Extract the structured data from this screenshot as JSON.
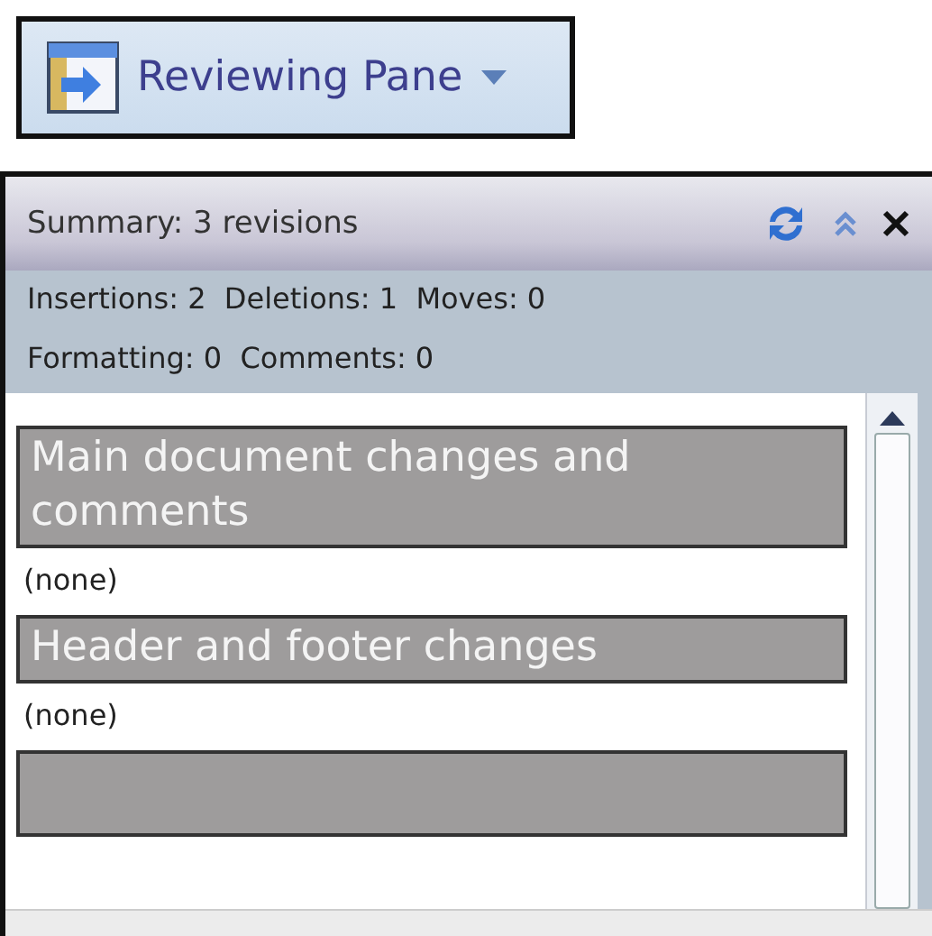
{
  "ribbon_button": {
    "label": "Reviewing Pane"
  },
  "pane": {
    "summary": "Summary: 3 revisions",
    "stats": [
      "Insertions: 2  Deletions: 1  Moves: 0",
      "Formatting: 0  Comments: 0"
    ],
    "sections": [
      {
        "kind": "full",
        "title": "Main document changes and comments",
        "content": "(none)"
      },
      {
        "kind": "full",
        "title": "Header and footer changes",
        "content": "(none)"
      },
      {
        "kind": "cut_off"
      }
    ]
  }
}
